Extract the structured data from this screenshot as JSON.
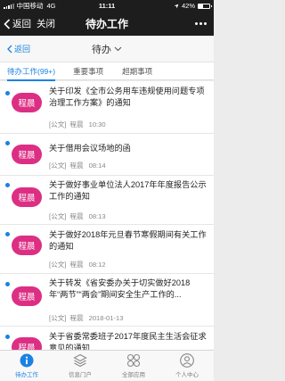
{
  "status_bar": {
    "carrier": "中国移动",
    "network": "4G",
    "time": "11:11",
    "battery": "42%"
  },
  "nav_bar": {
    "back_label": "返回",
    "close_label": "关闭",
    "title": "待办工作"
  },
  "sub_header": {
    "back_label": "返回",
    "title": "待办"
  },
  "tabs": [
    {
      "label": "待办工作(99+)",
      "active": true
    },
    {
      "label": "重要事项",
      "active": false
    },
    {
      "label": "超期事项",
      "active": false
    }
  ],
  "items": [
    {
      "avatar": "程晨",
      "title": "关于印发《全市公务用车违规使用问题专项治理工作方案》的通知",
      "type": "[公文]",
      "sender": "程晨",
      "time": "10:30"
    },
    {
      "avatar": "程晨",
      "title": "关于借用会议场地的函",
      "type": "[公文]",
      "sender": "程晨",
      "time": "08:14"
    },
    {
      "avatar": "程晨",
      "title": "关于做好事业单位法人2017年年度报告公示工作的通知",
      "type": "[公文]",
      "sender": "程晨",
      "time": "08:13"
    },
    {
      "avatar": "程晨",
      "title": "关于做好2018年元旦春节寒假期间有关工作的通知",
      "type": "[公文]",
      "sender": "程晨",
      "time": "08:12"
    },
    {
      "avatar": "程晨",
      "title": "关于转发《省安委办关于切实做好2018年“两节”“两会”期间安全生产工作的...",
      "type": "[公文]",
      "sender": "程晨",
      "time": "2018-01-13"
    },
    {
      "avatar": "程晨",
      "title": "关于省委常委班子2017年度民主生活会征求意见的通知",
      "type": "[公文]",
      "sender": "程晨",
      "time": ""
    }
  ],
  "bottom_tabs": [
    {
      "label": "待办工作",
      "icon": "info-icon",
      "active": true
    },
    {
      "label": "信息门户",
      "icon": "layers-icon",
      "active": false
    },
    {
      "label": "全部应用",
      "icon": "apps-icon",
      "active": false
    },
    {
      "label": "个人中心",
      "icon": "person-icon",
      "active": false
    }
  ],
  "colors": {
    "accent": "#1a82e2",
    "avatar_bg": "#dc2f84",
    "nav_bg": "#1d1d1d"
  }
}
